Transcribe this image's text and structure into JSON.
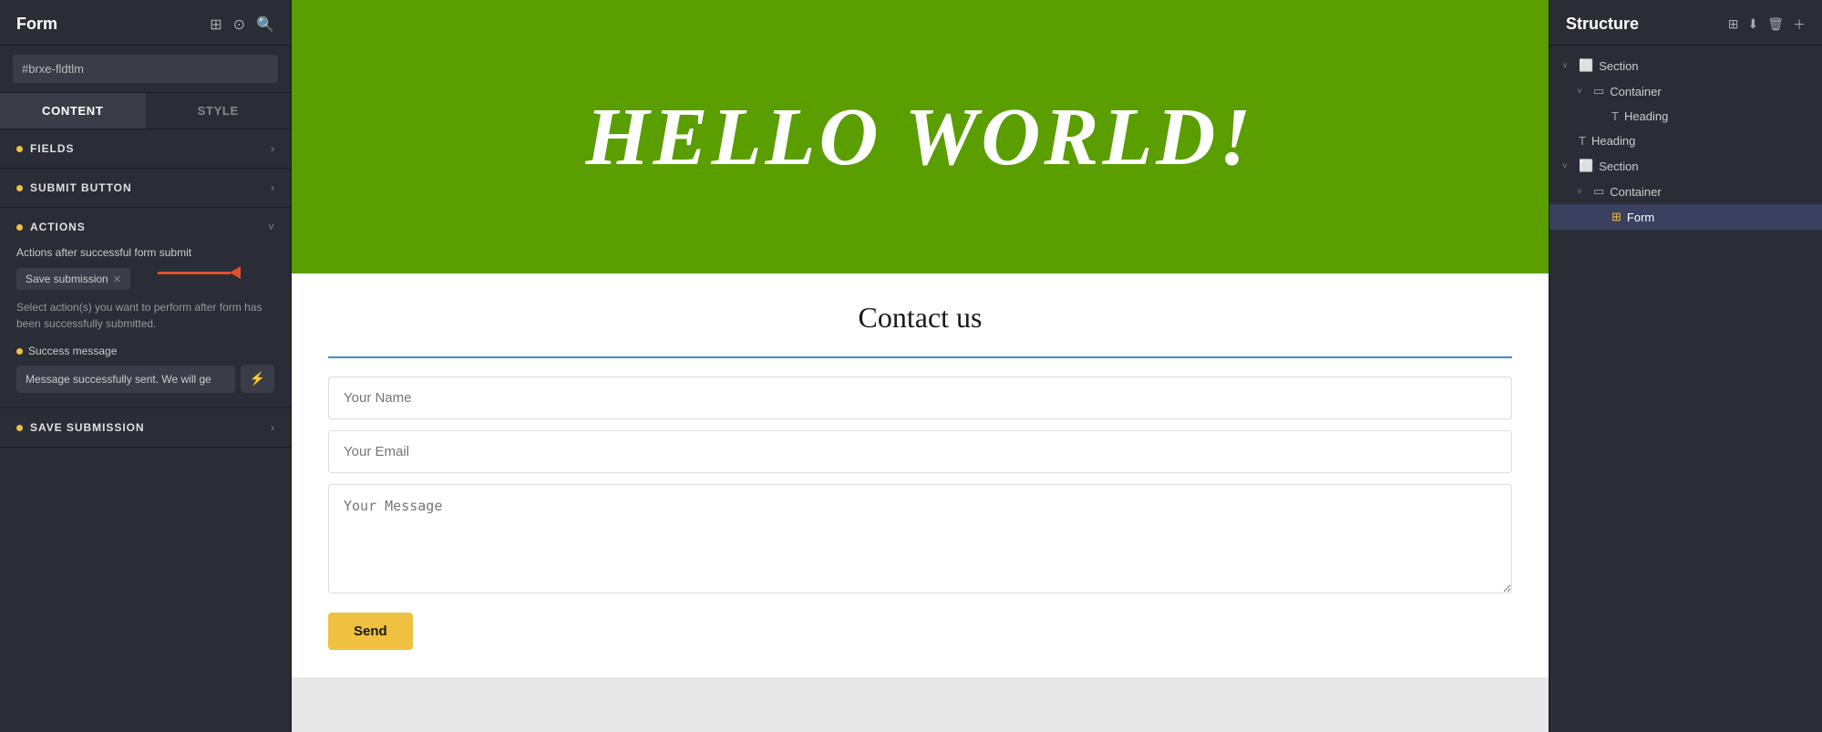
{
  "leftPanel": {
    "title": "Form",
    "idPlaceholder": "#brxe-fldtlm",
    "tabs": [
      {
        "label": "CONTENT",
        "active": true
      },
      {
        "label": "STYLE",
        "active": false
      }
    ],
    "sections": [
      {
        "label": "FIELDS",
        "dot": true
      },
      {
        "label": "SUBMIT BUTTON",
        "dot": true
      }
    ],
    "actions": {
      "label": "ACTIONS",
      "dot": true,
      "subtitle": "Actions after successful form submit",
      "tag": "Save submission",
      "hint": "Select action(s) you want to perform after form has been successfully submitted.",
      "successLabel": "Success message",
      "successValue": "Message successfully sent. We will ge"
    },
    "saveSubmission": {
      "label": "SAVE SUBMISSION",
      "dot": true
    }
  },
  "canvas": {
    "heroTitle": "HELLO WORLD!",
    "formTitle": "Contact us",
    "namePlaceholder": "Your Name",
    "emailPlaceholder": "Your Email",
    "messagePlaceholder": "Your Message",
    "sendLabel": "Send"
  },
  "rightPanel": {
    "title": "Structure",
    "tree": [
      {
        "label": "Section",
        "indent": 0,
        "icon": "section",
        "expanded": true
      },
      {
        "label": "Container",
        "indent": 1,
        "icon": "container",
        "expanded": true
      },
      {
        "label": "Heading",
        "indent": 2,
        "icon": "heading"
      },
      {
        "label": "Heading",
        "indent": 0,
        "icon": "heading"
      },
      {
        "label": "Section",
        "indent": 0,
        "icon": "section",
        "expanded": true
      },
      {
        "label": "Container",
        "indent": 1,
        "icon": "container",
        "expanded": true
      },
      {
        "label": "Form",
        "indent": 2,
        "icon": "form",
        "active": true
      }
    ]
  }
}
